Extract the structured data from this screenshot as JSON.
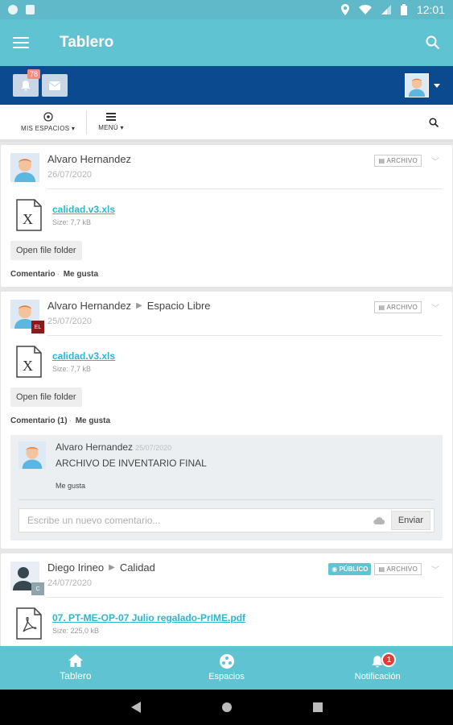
{
  "status_bar": {
    "time": "12:01"
  },
  "app_bar": {
    "title": "Tablero"
  },
  "blue_bar": {
    "notification_count": "78"
  },
  "sub_nav": {
    "spaces_label": "MIS ESPACIOS ▾",
    "menu_label": "MENÚ ▾"
  },
  "posts": [
    {
      "author": "Alvaro Hernandez",
      "space": "",
      "date": "26/07/2020",
      "type_tag": "ARCHIVO",
      "file_name": "calidad.v3.xls",
      "file_size": "Size: 7,7 kB",
      "open_label": "Open file folder",
      "comment_label": "Comentario",
      "like_label": "Me gusta"
    },
    {
      "author": "Alvaro Hernandez",
      "space": "Espacio Libre",
      "space_badge": "EL",
      "date": "25/07/2020",
      "type_tag": "ARCHIVO",
      "file_name": "calidad.v3.xls",
      "file_size": "Size: 7,7 kB",
      "open_label": "Open file folder",
      "comment_label": "Comentario (1)",
      "like_label": "Me gusta",
      "comment": {
        "author": "Alvaro Hernandez",
        "date": "25/07/2020",
        "text": "ARCHIVO DE INVENTARIO FINAL",
        "like_label": "Me gusta",
        "input_placeholder": "Escribe un nuevo comentario...",
        "send_label": "Enviar"
      }
    },
    {
      "author": "Diego Irineo",
      "space": "Calidad",
      "space_badge": "C",
      "date": "24/07/2020",
      "public_tag": "PÚBLICO",
      "type_tag": "ARCHIVO",
      "file_name": "07. PT-ME-OP-07 Julio regalado-PrIME.pdf",
      "file_size": "Size: 225,0 kB"
    }
  ],
  "bottom_nav": {
    "items": [
      "Tablero",
      "Espacios",
      "Notificación"
    ],
    "notification_badge": "1"
  },
  "colors": {
    "primary": "#5fc3d2",
    "secondary": "#0b4a8f",
    "link": "#2bb7cc",
    "badge": "#e53935"
  }
}
